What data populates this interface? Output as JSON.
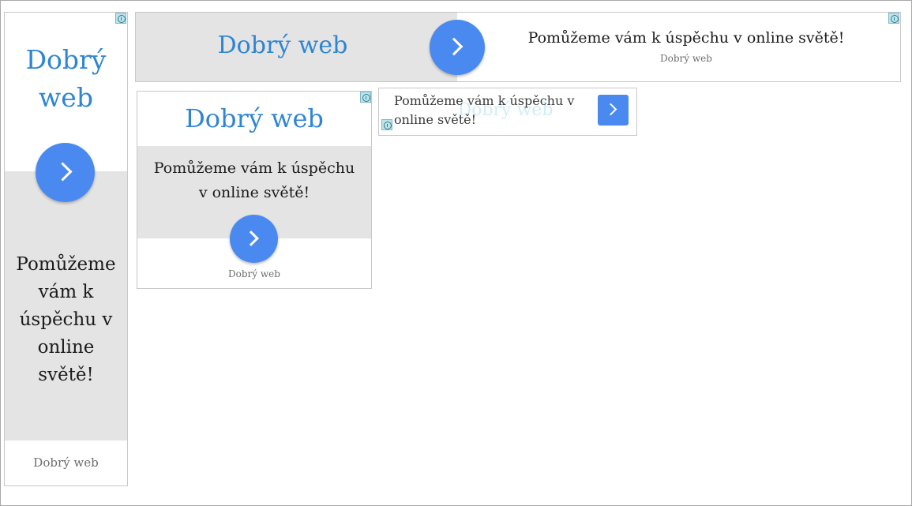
{
  "ads": {
    "brand": "Dobrý web",
    "headline": "Pomůžeme vám k úspěchu v online světě!",
    "left": {
      "brand_line1": "Dobrý",
      "brand_line2": "web",
      "headline_lines": [
        "Pomůžeme",
        "vám k",
        "úspěchu v",
        "online",
        "světě!"
      ],
      "footer": "Dobrý web"
    },
    "top": {
      "brand": "Dobrý web",
      "headline": "Pomůžeme vám k úspěchu v online světě!",
      "footer": "Dobrý web"
    },
    "mid": {
      "brand": "Dobrý web",
      "headline_line1": "Pomůžeme vám k úspěchu",
      "headline_line2": "v online světě!",
      "footer": "Dobrý web"
    },
    "small": {
      "ghost_brand": "Dobrý web",
      "headline_line1": "Pomůžeme vám k úspěchu v",
      "headline_line2": "online světě!"
    }
  },
  "icons": {
    "info": "info-icon",
    "next": "chevron-right-icon"
  },
  "colors": {
    "brand": "#2e85d3",
    "button": "#4a8af0",
    "panel": "#e4e4e4"
  }
}
